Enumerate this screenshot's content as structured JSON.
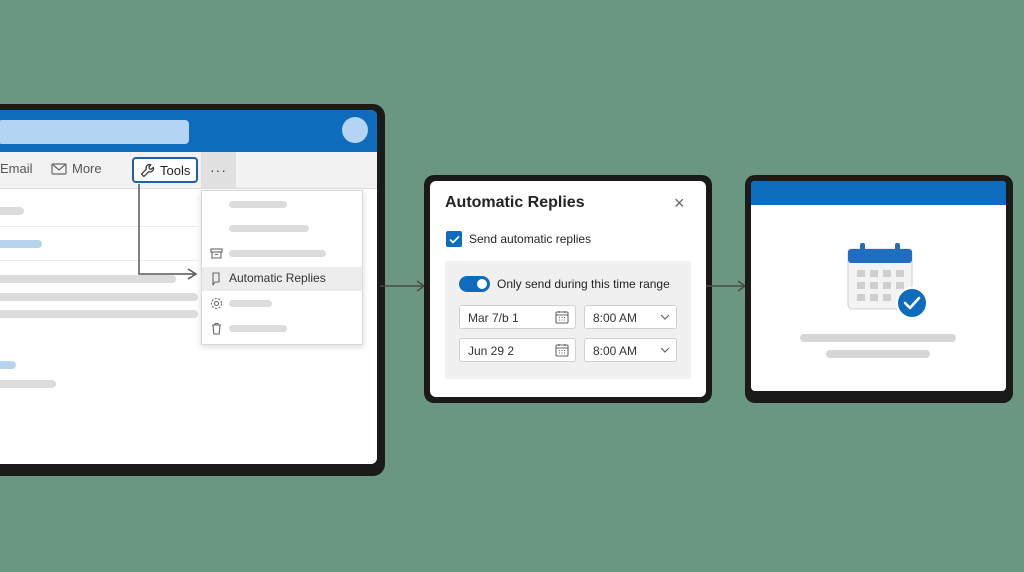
{
  "toolbar": {
    "email_label": "Email",
    "more_label": "More",
    "tools_label": "Tools",
    "overflow_label": "···"
  },
  "dropdown": {
    "highlighted_item": "Automatic Replies"
  },
  "dialog": {
    "title": "Automatic Replies",
    "close_label": "×",
    "send_auto_replies_label": "Send automatic replies",
    "send_auto_replies_checked": true,
    "time_range_label": "Only send during this time range",
    "time_range_enabled": true,
    "start_date": "Mar 7/b 1",
    "start_time": "8:00 AM",
    "end_date": "Jun 29 2",
    "end_time": "8:00 AM"
  },
  "colors": {
    "background": "#6b9782",
    "accent": "#0f6cbd",
    "device_frame": "#1a1a1a"
  },
  "icons": {
    "trash": "trash-icon",
    "mail": "mail-icon",
    "wrench": "wrench-icon",
    "archive": "archive-icon",
    "auto_reply": "auto-reply-icon",
    "calendar": "calendar-icon",
    "checkmark": "checkmark-icon",
    "chevron": "chevron-down-icon"
  }
}
